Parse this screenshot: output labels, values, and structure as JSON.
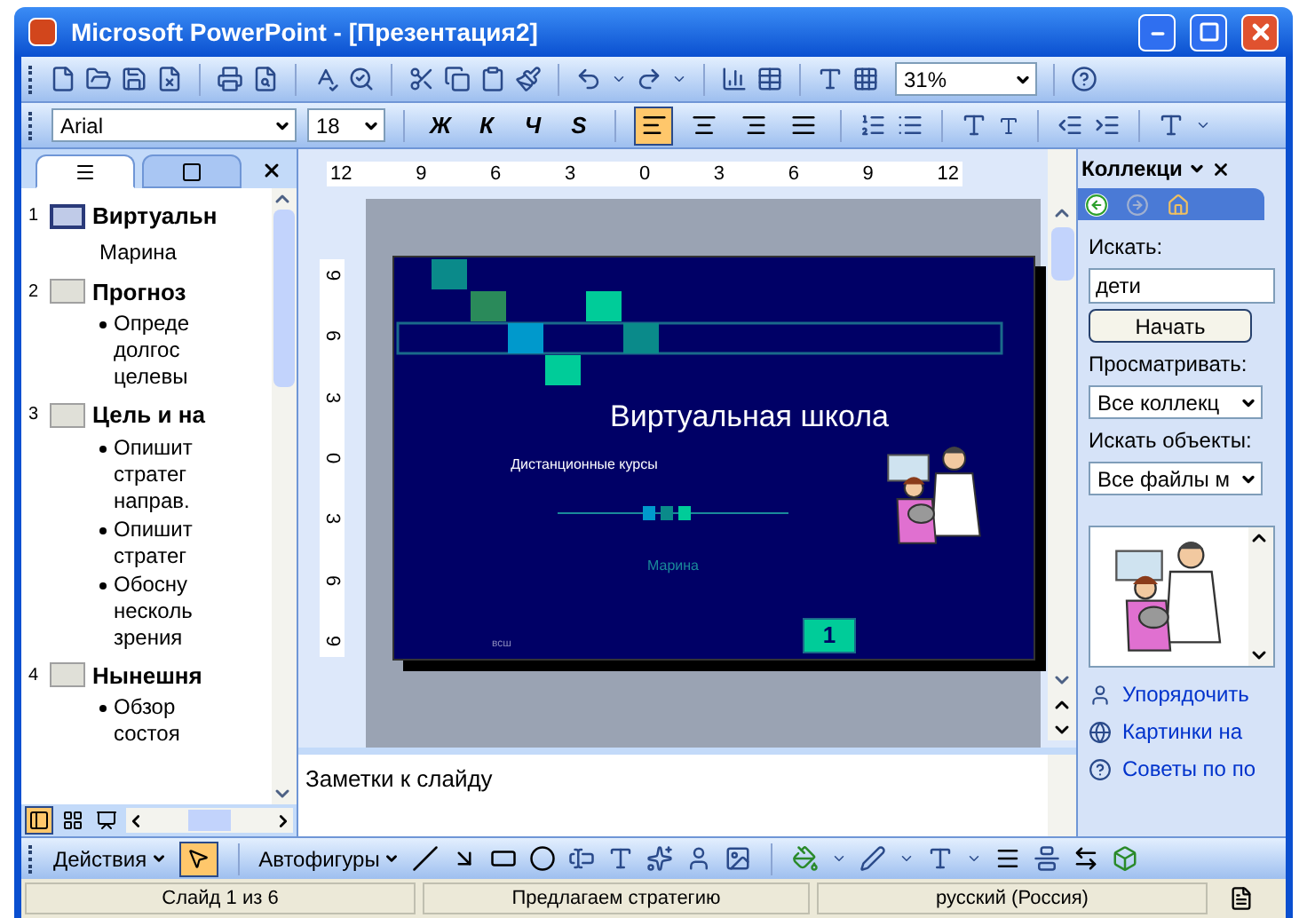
{
  "window": {
    "title": "Microsoft PowerPoint - [Презентация2]"
  },
  "toolbar": {
    "zoom": "31%"
  },
  "format_toolbar": {
    "font": "Arial",
    "size": "18",
    "styles": [
      {
        "label": "Ж"
      },
      {
        "label": "К"
      },
      {
        "label": "Ч"
      },
      {
        "label": "S"
      }
    ],
    "align": [
      {
        "kind": "left",
        "selected": true
      },
      {
        "kind": "center",
        "selected": false
      },
      {
        "kind": "right",
        "selected": false
      },
      {
        "kind": "justify",
        "selected": false
      }
    ]
  },
  "outline_pane": {
    "tabs": [
      {
        "kind": "outline",
        "selected": true
      },
      {
        "kind": "slides",
        "selected": false
      }
    ],
    "slides": [
      {
        "number": "1",
        "title": "Виртуальн",
        "selected": true,
        "subtitle": "Марина"
      },
      {
        "number": "2",
        "title": "Прогноз",
        "selected": false,
        "bullets": [
          [
            "Опреде",
            "долгос",
            "целевы"
          ]
        ]
      },
      {
        "number": "3",
        "title": "Цель и на",
        "selected": false,
        "bullets": [
          [
            "Опишит",
            "стратег",
            "направ."
          ],
          [
            "Опишит",
            "стратег"
          ],
          [
            "Обосну",
            "несколь",
            "зрения"
          ]
        ]
      },
      {
        "number": "4",
        "title": "Нынешня",
        "selected": false,
        "bullets": [
          [
            "Обзор",
            "состоя"
          ]
        ]
      }
    ],
    "views": [
      {
        "kind": "normal",
        "selected": true
      },
      {
        "kind": "sorter",
        "selected": false
      },
      {
        "kind": "show",
        "selected": false
      }
    ]
  },
  "rulers": {
    "horizontal": [
      "12",
      "9",
      "6",
      "3",
      "0",
      "3",
      "6",
      "9",
      "12"
    ],
    "vertical": [
      "9",
      "6",
      "3",
      "0",
      "3",
      "6",
      "9"
    ]
  },
  "slide": {
    "title": "Виртуальная школа",
    "subtitle": "Дистанционные курсы",
    "author": "Марина",
    "footer": "всш",
    "number": "1"
  },
  "notes": {
    "placeholder": "Заметки к слайду"
  },
  "task_pane": {
    "title": "Коллекци",
    "search_label": "Искать:",
    "search_value": "дети",
    "go_button": "Начать",
    "browse_label": "Просматривать:",
    "browse_value": "Все коллекц",
    "types_label": "Искать объекты:",
    "types_value": "Все файлы м",
    "links": [
      "Упорядочить",
      "Картинки на",
      "Советы по по"
    ]
  },
  "draw_toolbar": {
    "actions": "Действия",
    "autoshapes": "Автофигуры"
  },
  "status_bar": [
    "Слайд 1 из 6",
    "Предлагаем стратегию",
    "русский (Россия)"
  ]
}
